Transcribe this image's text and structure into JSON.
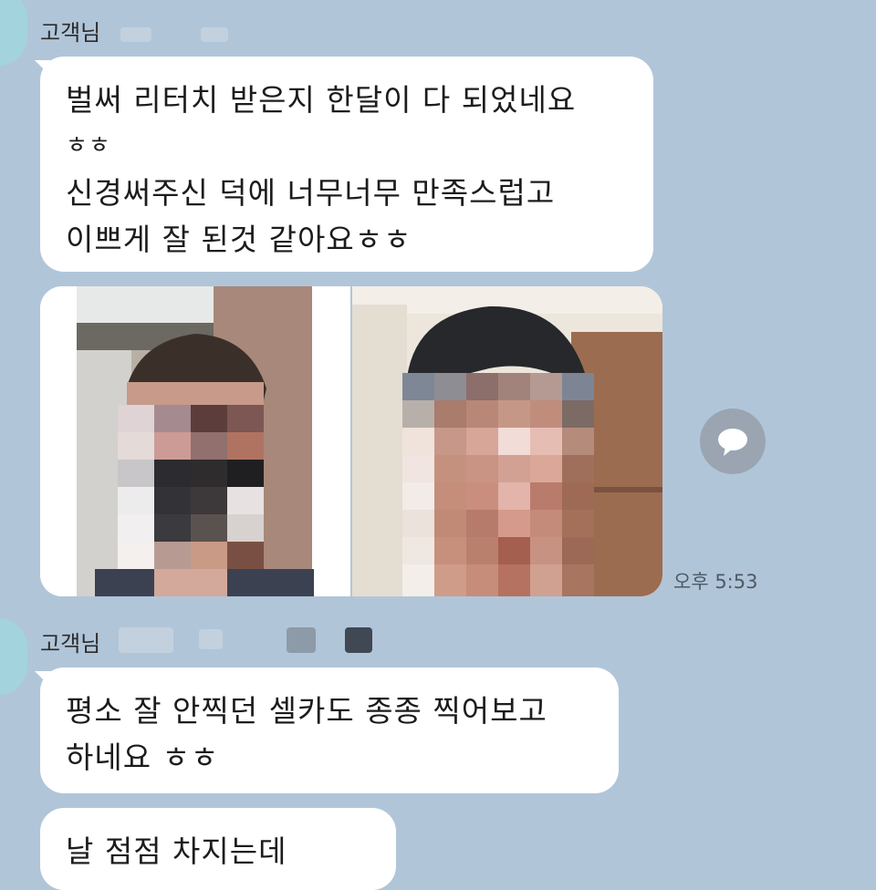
{
  "chat": {
    "messages": [
      {
        "sender": "고객님",
        "bubble_lines": [
          "벌써 리터치 받은지 한달이 다 되었네요",
          "ㅎㅎ",
          "신경써주신 덕에 너무너무 만족스럽고",
          "이쁘게 잘 된것 같아요ㅎㅎ"
        ],
        "time": "오후 5:53"
      },
      {
        "sender": "고객님",
        "bubble_lines": [
          "평소 잘 안찍던 셀카도 종종 찍어보고",
          "하네요 ㅎㅎ"
        ]
      },
      {
        "bubble_lines": [
          "날 점점 차지는데"
        ]
      }
    ]
  },
  "icons": {
    "share": "speech-bubble-icon",
    "avatar": "profile-avatar"
  },
  "colors": {
    "background": "#b1c5d9",
    "bubble": "#ffffff",
    "avatar": "#a3d3dd",
    "share_button": "#9aa5b1"
  }
}
